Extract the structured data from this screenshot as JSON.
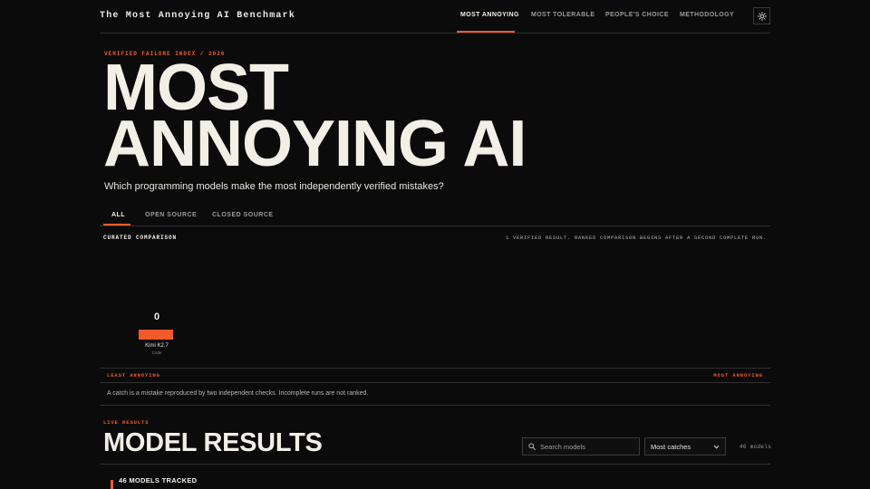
{
  "header": {
    "brand": "The Most Annoying AI Benchmark",
    "nav": [
      "MOST ANNOYING",
      "MOST TOLERABLE",
      "PEOPLE'S CHOICE",
      "METHODOLOGY"
    ],
    "active_nav": "MOST ANNOYING",
    "theme_icon": "sun-icon"
  },
  "hero": {
    "eyebrow": "VERIFIED FAILURE INDEX / 2026",
    "title_line1": "MOST",
    "title_line2": "ANNOYING AI",
    "subtitle": "Which programming models make the most independently verified mistakes?"
  },
  "filters": {
    "tabs": [
      "ALL",
      "OPEN SOURCE",
      "CLOSED SOURCE"
    ],
    "active": "ALL"
  },
  "comparison": {
    "label": "CURATED COMPARISON",
    "note": "1 VERIFIED RESULT. RANKED COMPARISON BEGINS AFTER A SECOND COMPLETE RUN.",
    "axis_left": "LEAST ANNOYING",
    "axis_right": "MOST ANNOYING",
    "footnote": "A catch is a mistake reproduced by two independent checks. Incomplete runs are not ranked."
  },
  "chart_data": {
    "type": "bar",
    "categories": [
      "Kimi K2.7"
    ],
    "sublabels": [
      "Code"
    ],
    "values": [
      0
    ],
    "bar_color": "#f15a2b"
  },
  "results": {
    "eyebrow": "LIVE RESULTS",
    "title": "MODEL RESULTS",
    "search_placeholder": "Search models",
    "sort_value": "Most catches",
    "count": "46 models",
    "tracked": "46 MODELS TRACKED"
  },
  "colors": {
    "accent": "#f15a2b",
    "background": "#0b0b0c",
    "text": "#f2efe6"
  }
}
